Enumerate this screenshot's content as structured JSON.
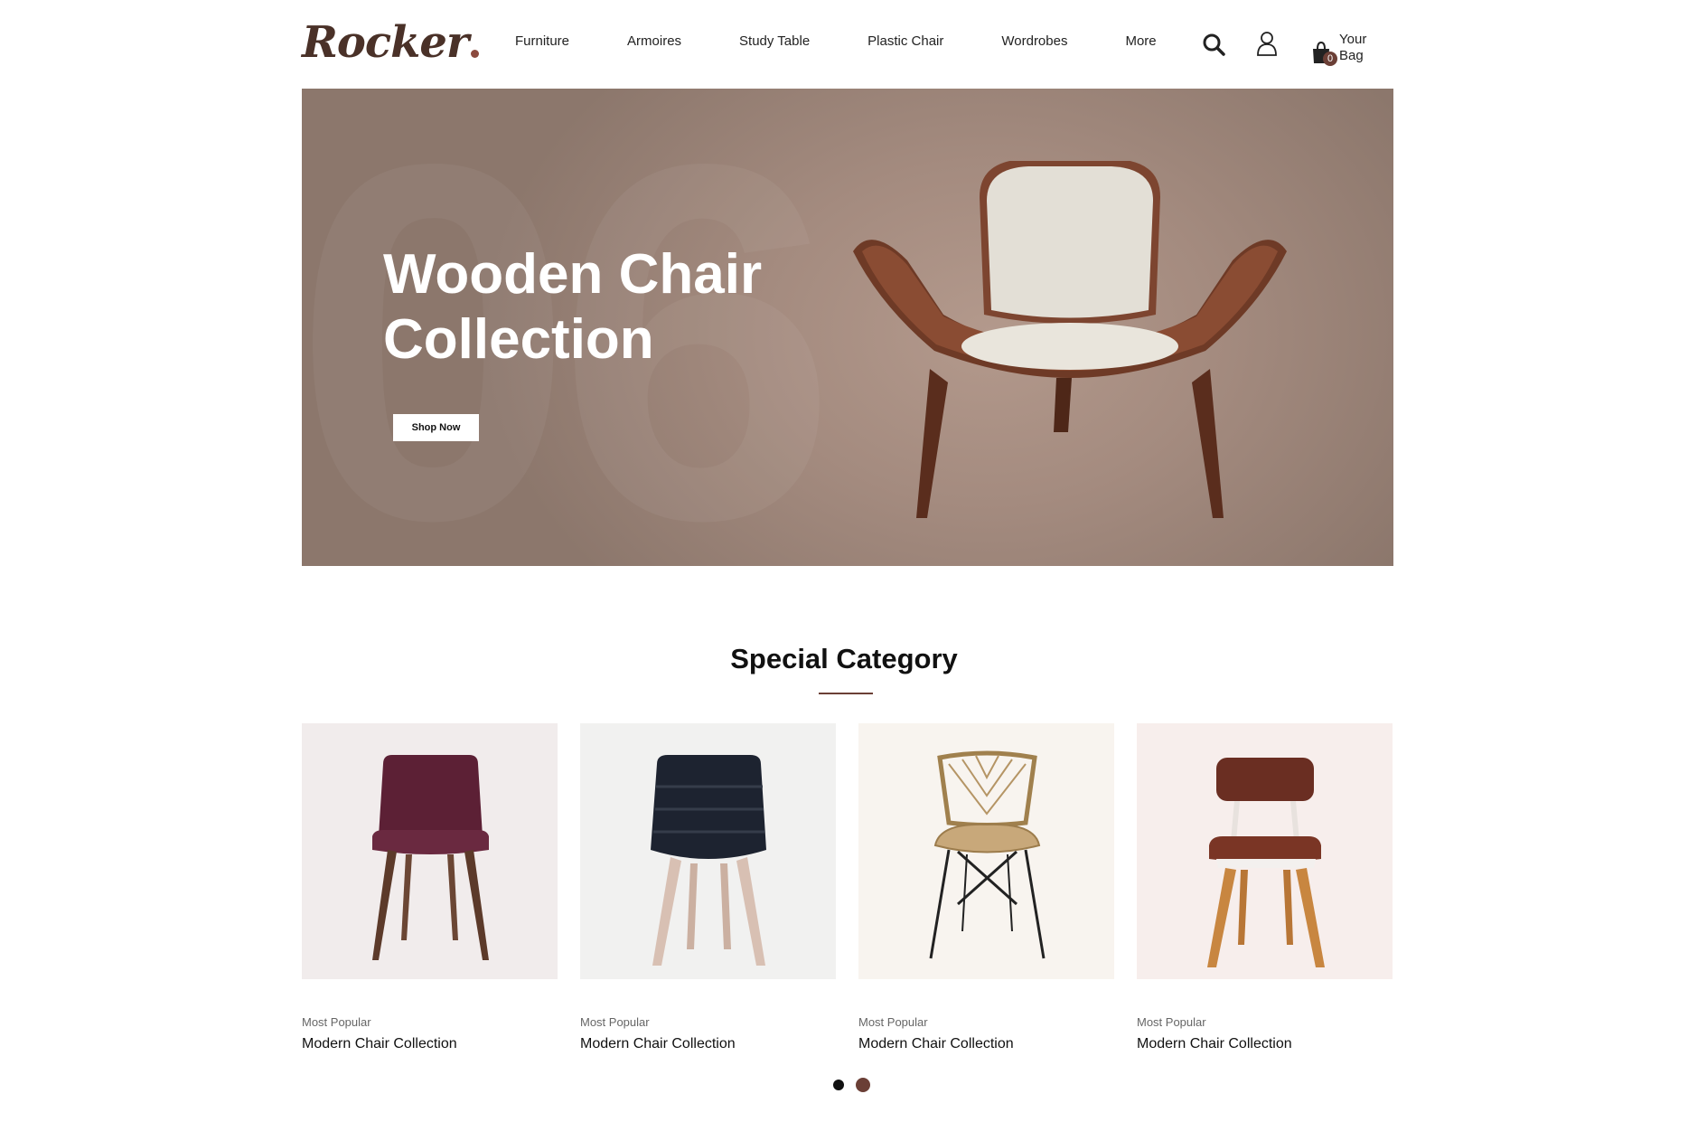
{
  "header": {
    "logo": "Rocker",
    "nav": [
      "Furniture",
      "Armoires",
      "Study Table",
      "Plastic Chair",
      "Wordrobes",
      "More"
    ],
    "icons": {
      "search": "search-icon",
      "account": "user-icon",
      "bag": "shopping-bag-icon"
    },
    "bag_count": "0",
    "bag_label": "Your Bag"
  },
  "hero": {
    "bg_number": "06",
    "title": "Wooden Chair Collection",
    "button": "Shop Now"
  },
  "special": {
    "title": "Special Category",
    "cards": [
      {
        "subtitle": "Most Popular",
        "title": "Modern Chair Collection",
        "bg": "#f1ecec"
      },
      {
        "subtitle": "Most Popular",
        "title": "Modern Chair Collection",
        "bg": "#f1f1f0"
      },
      {
        "subtitle": "Most Popular",
        "title": "Modern Chair Collection",
        "bg": "#f8f4ef"
      },
      {
        "subtitle": "Most Popular",
        "title": "Modern Chair Collection",
        "bg": "#f7eeec"
      }
    ]
  },
  "colors": {
    "accent": "#6b3f36",
    "hero_bg": "#a48b7f",
    "text": "#111111"
  }
}
